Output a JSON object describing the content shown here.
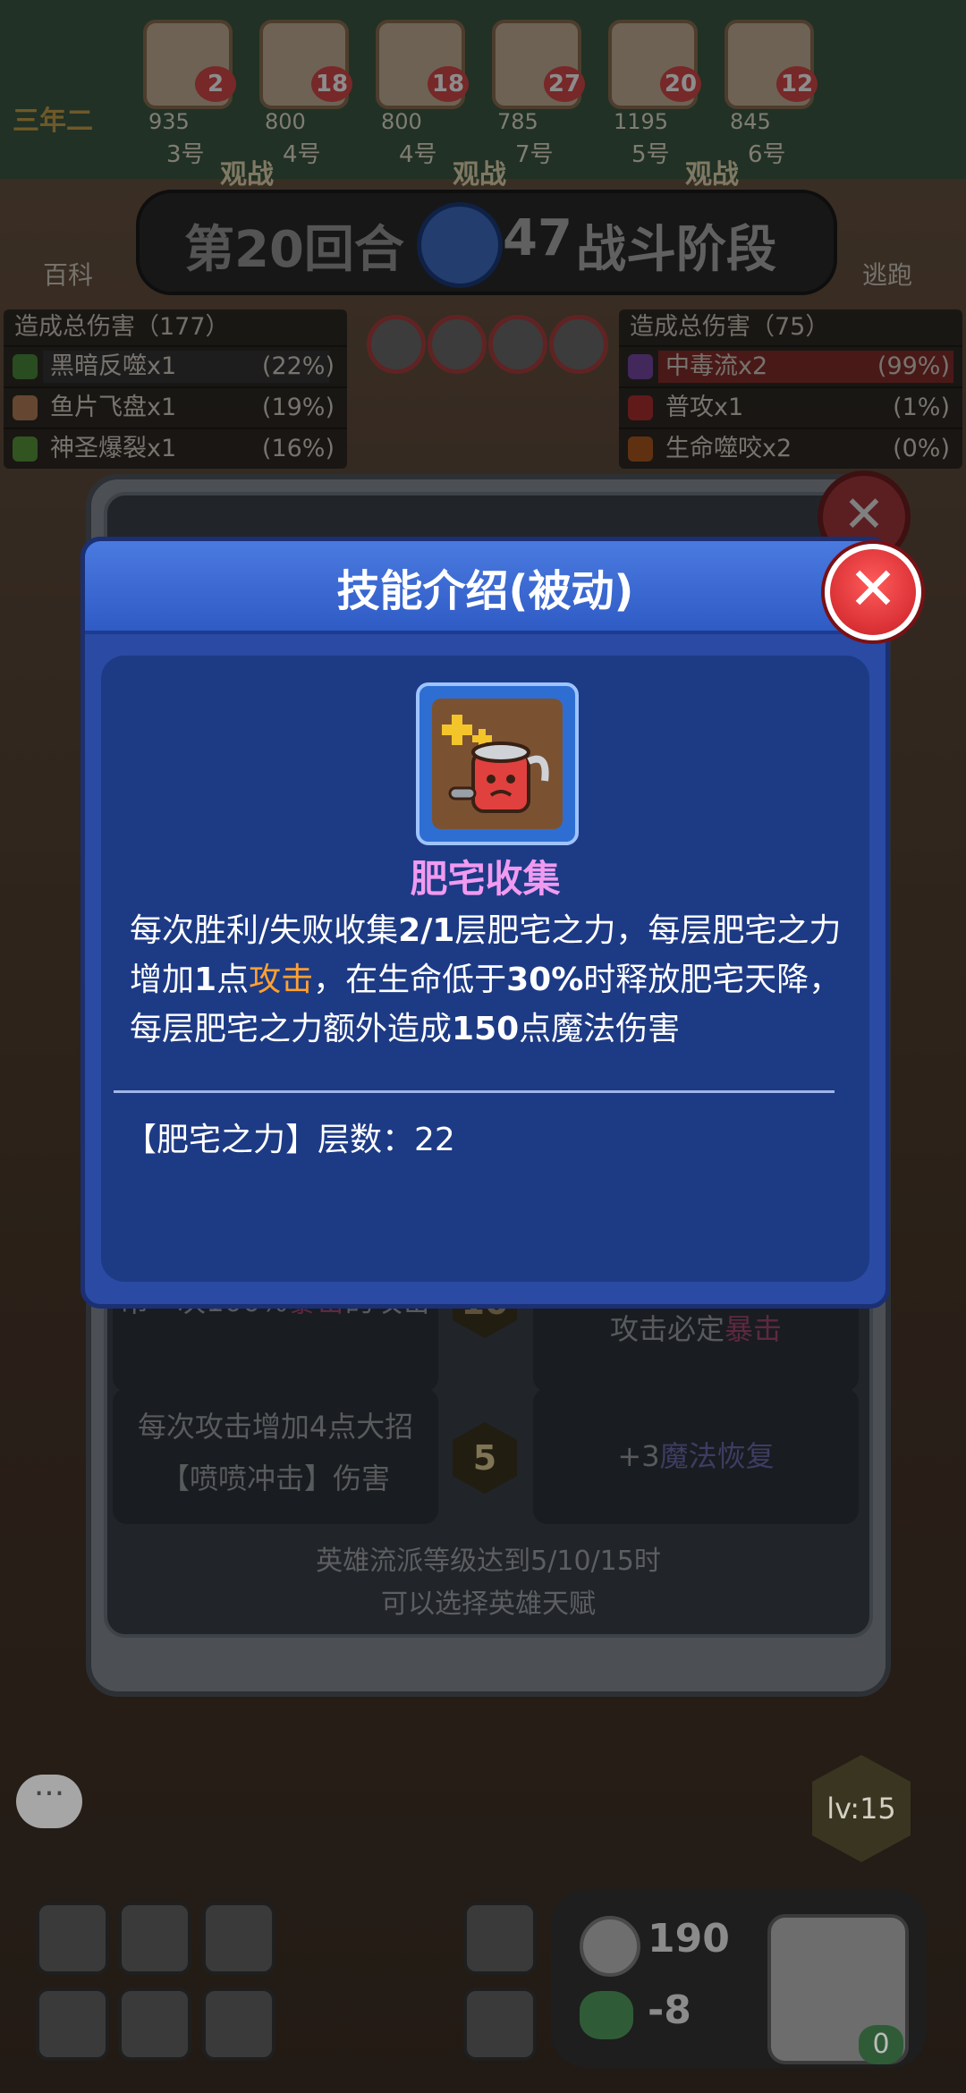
{
  "top": {
    "opponents": [
      {
        "hearts": "2",
        "coins": "935",
        "pos": "3号"
      },
      {
        "hearts": "18",
        "coins": "800",
        "pos": "4号"
      },
      {
        "hearts": "18",
        "coins": "800",
        "pos": "4号"
      },
      {
        "hearts": "27",
        "coins": "785",
        "pos": "7号"
      },
      {
        "hearts": "20",
        "coins": "1195",
        "pos": "5号"
      },
      {
        "hearts": "12",
        "coins": "845",
        "pos": "6号"
      }
    ],
    "watch_labels": [
      "观战",
      "观战",
      "观战"
    ],
    "class_label": "三年二",
    "encyclopedia_label": "百科",
    "escape_label": "逃跑"
  },
  "round": {
    "round_text": "第20回合",
    "timer": "47",
    "phase": "战斗阶段"
  },
  "damage": {
    "left": {
      "header": "造成总伤害（177）",
      "rows": [
        {
          "name": "黑暗反噬x1",
          "pct": "(22%)"
        },
        {
          "name": "鱼片飞盘x1",
          "pct": "(19%)"
        },
        {
          "name": "神圣爆裂x1",
          "pct": "(16%)"
        }
      ]
    },
    "right": {
      "header": "造成总伤害（75）",
      "rows": [
        {
          "name": "中毒流x2",
          "pct": "(99%)"
        },
        {
          "name": "普攻x1",
          "pct": "(1%)"
        },
        {
          "name": "生命噬咬x2",
          "pct": "(0%)"
        }
      ]
    }
  },
  "back_modal": {
    "close_glyph": "✕",
    "talents": [
      {
        "text_a": "吊一次100%",
        "text_hl": "暴击",
        "text_b": "的攻击"
      },
      {
        "text_a": "攻击必定",
        "text_hl": "暴击",
        "text_b": ""
      },
      {
        "text": "每次攻击增加4点大招【喷喷冲击】伤害"
      },
      {
        "text_a": "+3",
        "text_mg": "魔法恢复"
      }
    ],
    "hex_top": "10",
    "hex_mid": "5",
    "note_line1": "英雄流派等级达到5/10/15时",
    "note_line2": "可以选择英雄天赋"
  },
  "modal": {
    "title": "技能介绍(被动)",
    "close_glyph": "✕",
    "skill_name": "肥宅收集",
    "desc": {
      "p1": "每次胜利/失败收集",
      "p1b": "2/1",
      "p2": "层肥宅之力，每层肥宅之力增加",
      "p2b": "1",
      "p3": "点",
      "atk": "攻击",
      "p4": "，在生命低于",
      "p4b": "30%",
      "p5": "时释放肥宅天降，每层肥宅之力额外造成",
      "p5b": "150",
      "p6": "点魔法伤害"
    },
    "layers_text": "【肥宅之力】层数：22"
  },
  "hud": {
    "coins": "190",
    "hp": "-8",
    "level": "lv:15",
    "hero_count": "0",
    "chat_glyph": "···"
  }
}
